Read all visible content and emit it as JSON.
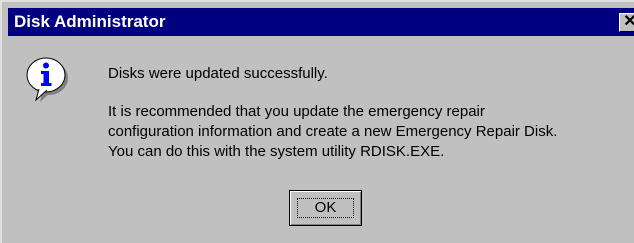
{
  "window": {
    "title": "Disk Administrator",
    "close_label": "✕"
  },
  "message": {
    "icon": "information-icon",
    "line1": "Disks were updated successfully.",
    "paragraph": [
      "It is recommended that you update the emergency repair",
      "configuration information and create a new Emergency Repair Disk.",
      "You can do this with the system utility RDISK.EXE."
    ]
  },
  "buttons": {
    "ok_label": "OK"
  },
  "colors": {
    "titlebar": "#000080",
    "face": "#c0c0c0",
    "icon_blue": "#0000ff"
  }
}
